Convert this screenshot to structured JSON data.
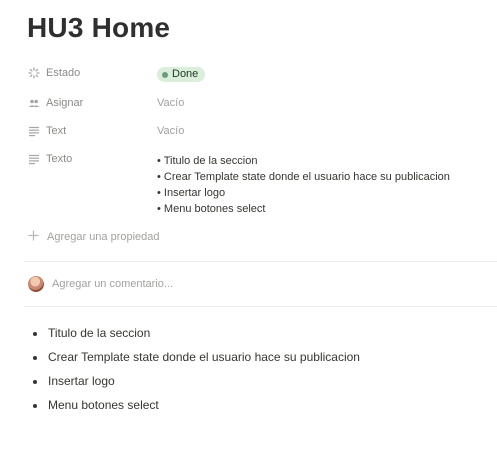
{
  "page": {
    "title": "HU3 Home"
  },
  "properties": {
    "estado": {
      "label": "Estado",
      "value": "Done",
      "icon": "status-icon",
      "color": "#dbeddb"
    },
    "asignar": {
      "label": "Asignar",
      "value": "Vacío",
      "icon": "people-icon"
    },
    "text": {
      "label": "Text",
      "value": "Vacío",
      "icon": "text-lines-icon"
    },
    "texto": {
      "label": "Texto",
      "icon": "text-lines-icon",
      "items": [
        "Titulo de la seccion",
        "Crear Template state donde el usuario hace su publicacion",
        "Insertar logo",
        "Menu botones select"
      ]
    }
  },
  "add_property": {
    "label": "Agregar una propiedad",
    "icon": "plus-icon"
  },
  "comment": {
    "placeholder": "Agregar un comentario..."
  },
  "content": {
    "bullets": [
      "Titulo de la seccion",
      "Crear Template state donde el usuario hace su publicacion",
      "Insertar logo",
      "Menu botones select"
    ]
  }
}
